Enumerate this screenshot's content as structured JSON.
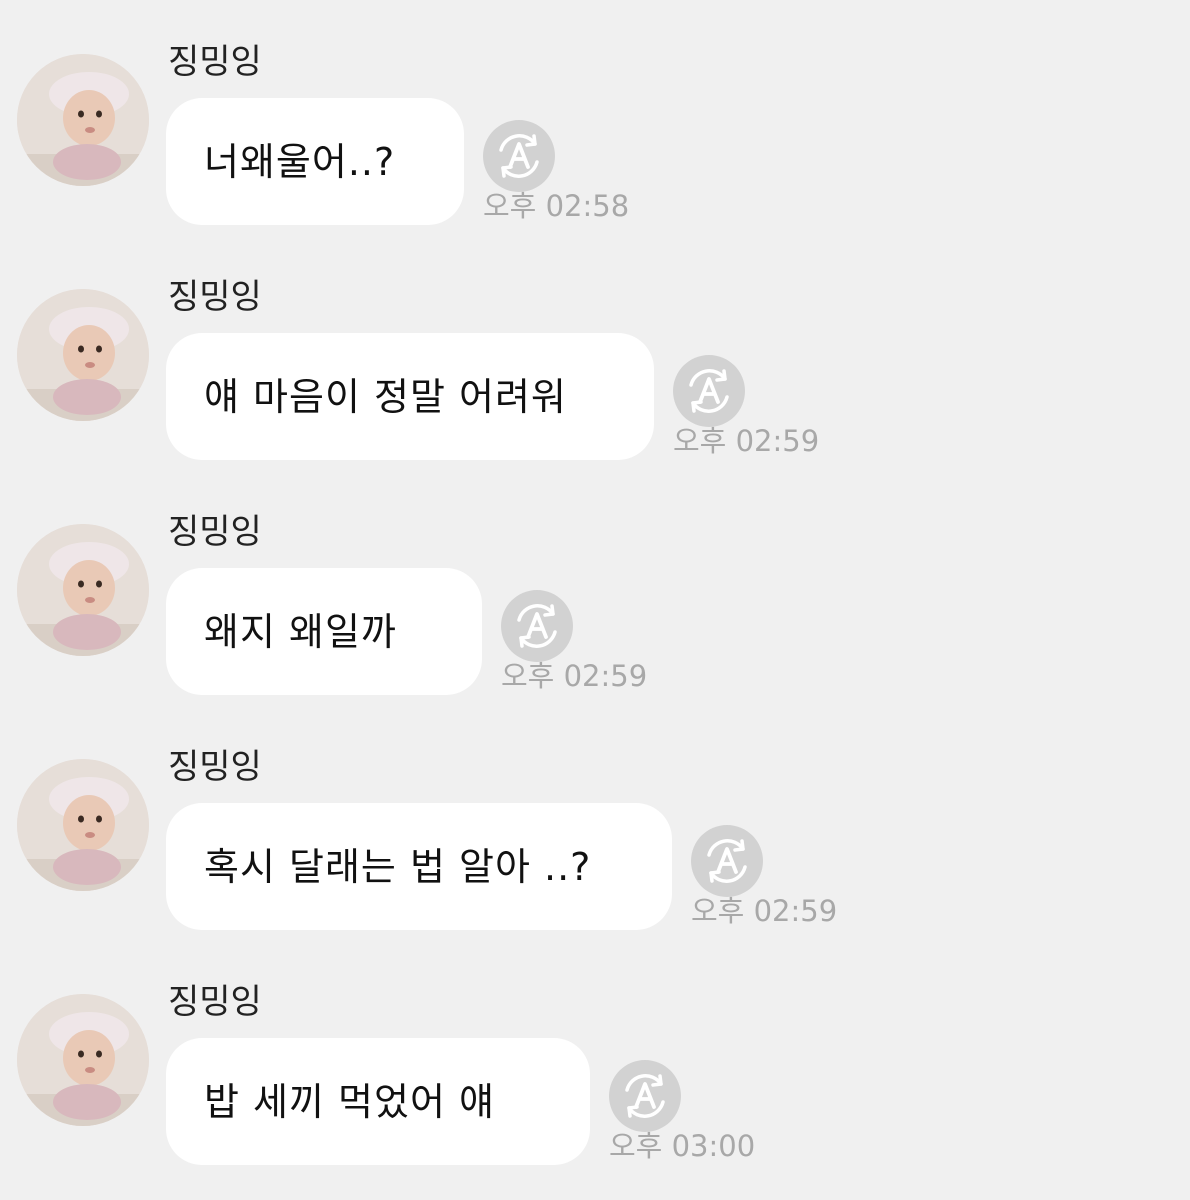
{
  "messages": [
    {
      "sender": "징밍잉",
      "text": "너왜울어..?",
      "time": "오후 02:58",
      "avatar_icon": "baby-photo-avatar",
      "translate_icon": "translate-a-icon"
    },
    {
      "sender": "징밍잉",
      "text": "얘 마음이 정말 어려워",
      "time": "오후 02:59",
      "avatar_icon": "baby-photo-avatar",
      "translate_icon": "translate-a-icon"
    },
    {
      "sender": "징밍잉",
      "text": "왜지 왜일까",
      "time": "오후 02:59",
      "avatar_icon": "baby-photo-avatar",
      "translate_icon": "translate-a-icon"
    },
    {
      "sender": "징밍잉",
      "text": "혹시 달래는 법 알아 ..?",
      "time": "오후 02:59",
      "avatar_icon": "baby-photo-avatar",
      "translate_icon": "translate-a-icon"
    },
    {
      "sender": "징밍잉",
      "text": "밥 세끼 먹었어 얘",
      "time": "오후 03:00",
      "avatar_icon": "baby-photo-avatar",
      "translate_icon": "translate-a-icon"
    }
  ],
  "colors": {
    "background": "#f0f0f0",
    "bubble": "#ffffff",
    "text": "#111111",
    "sender": "#222222",
    "timestamp": "#a8a8a8",
    "translate_button": "#d2d2d2"
  }
}
